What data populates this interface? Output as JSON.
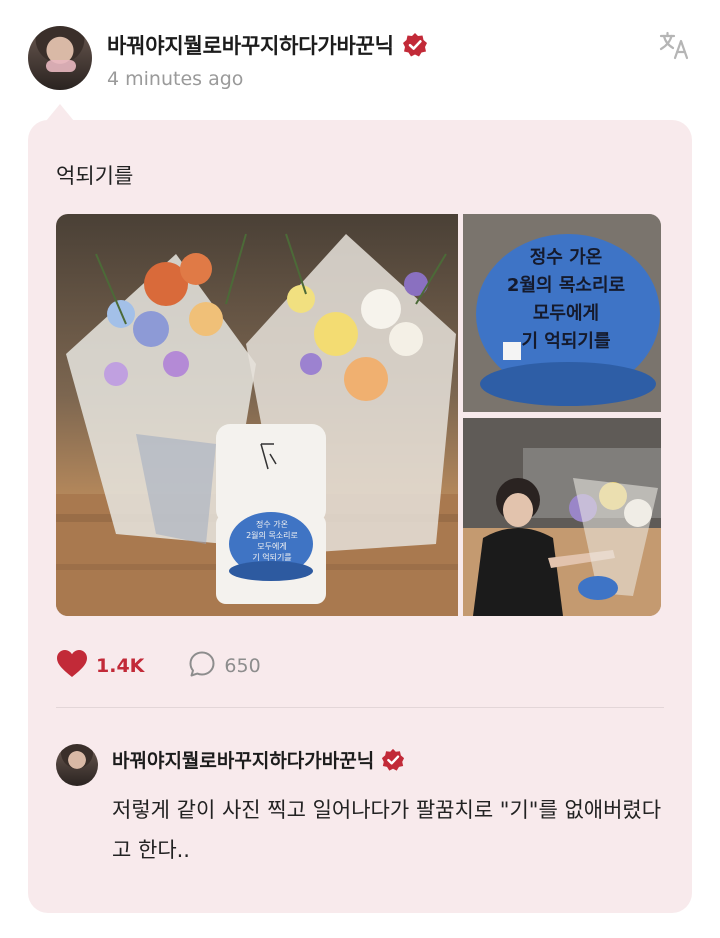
{
  "post": {
    "author": "바꿔야지뭘로바꾸지하다가바꾼닉",
    "time": "4 minutes ago",
    "text": "억되기를",
    "likes": "1.4K",
    "comments": "650",
    "images": [
      {
        "icon": "bouquet-photo"
      },
      {
        "icon": "cake-photo",
        "cake_text": [
          "정수 가온",
          "2월의 목소리로",
          "모두에게",
          "기 억되기를"
        ]
      },
      {
        "icon": "selfie-photo"
      }
    ],
    "small_cake_text": [
      "정수 가온",
      "2월의 목소리로",
      "모두에게",
      "기 억되기를"
    ]
  },
  "reply": {
    "author": "바꿔야지뭘로바꾸지하다가바꾼닉",
    "text": "저렇게 같이 사진 찍고 일어나다가 팔꿈치로 \"기\"를 없애버렸다고 한다.."
  },
  "colors": {
    "bubble": "#f8eaec",
    "accent_red": "#c22a38",
    "verified": "#c22a38",
    "muted": "#9a9a9a"
  }
}
